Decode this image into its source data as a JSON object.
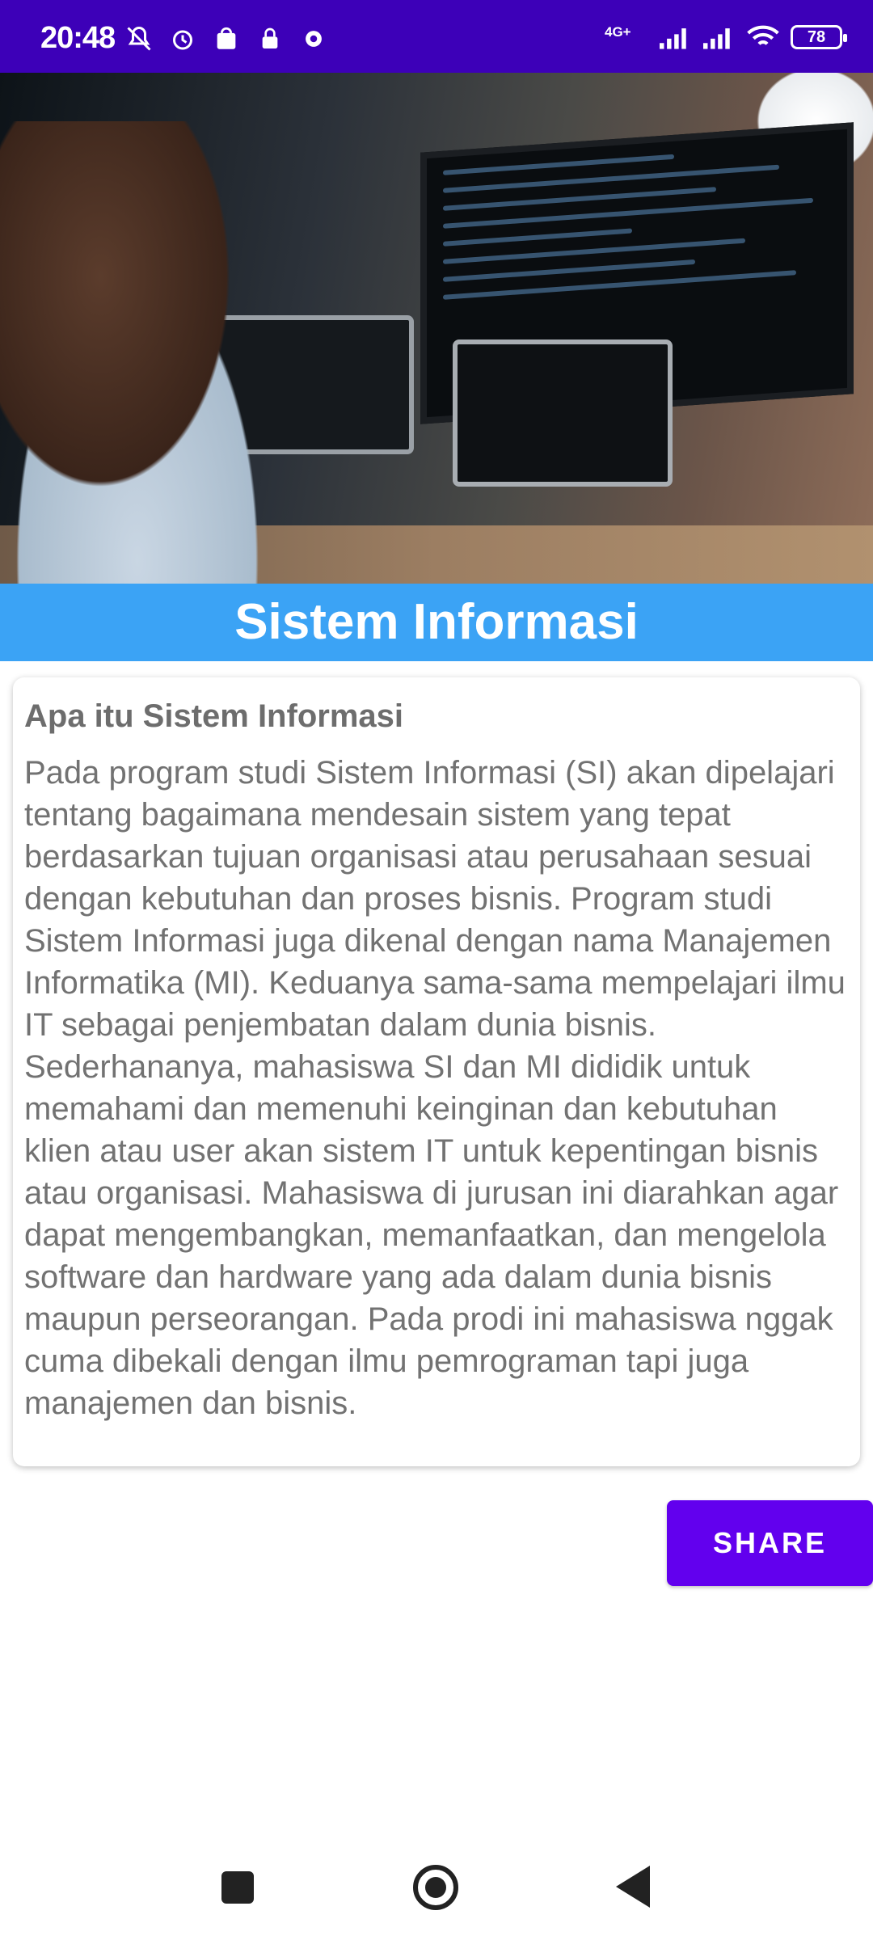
{
  "status_bar": {
    "time": "20:48",
    "network_label": "4G+",
    "battery": "78",
    "icons_left": [
      "mute-icon",
      "alarm-icon",
      "shopping-bag-icon",
      "vpn-icon",
      "settings-icon"
    ],
    "icons_right": [
      "signal-icon",
      "signal-icon",
      "wifi-icon",
      "battery-icon"
    ]
  },
  "hero": {
    "image": "developer-working-on-computers-photo"
  },
  "title_bar": {
    "title": "Sistem Informasi",
    "color": "#3ba3f5"
  },
  "card": {
    "heading": "Apa itu Sistem Informasi",
    "body": "Pada program studi Sistem Informasi (SI) akan dipelajari tentang bagaimana mendesain sistem yang tepat berdasarkan tujuan organisasi atau perusahaan sesuai dengan kebutuhan dan proses bisnis. Program studi Sistem Informasi juga dikenal dengan nama Manajemen Informatika (MI). Keduanya sama-sama mempelajari ilmu IT sebagai penjembatan dalam dunia bisnis. Sederhananya, mahasiswa SI dan MI dididik untuk memahami dan memenuhi keinginan dan kebutuhan klien atau user akan sistem IT untuk kepentingan bisnis atau organisasi. Mahasiswa di jurusan ini diarahkan agar dapat mengembangkan, memanfaatkan, dan mengelola software dan hardware yang ada dalam dunia bisnis maupun perseorangan. Pada prodi ini mahasiswa nggak cuma dibekali dengan ilmu pemrograman tapi juga manajemen dan bisnis."
  },
  "actions": {
    "share_label": "SHARE",
    "accent": "#6200ee"
  },
  "nav": {
    "buttons": [
      "recent-apps",
      "home",
      "back"
    ]
  }
}
